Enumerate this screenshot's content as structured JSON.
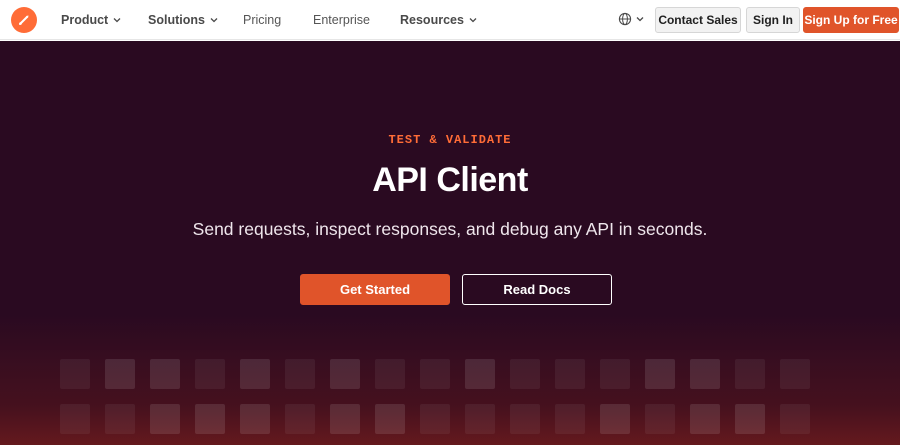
{
  "nav": {
    "items": [
      {
        "label": "Product",
        "has_menu": true
      },
      {
        "label": "Solutions",
        "has_menu": true
      },
      {
        "label": "Pricing",
        "has_menu": false
      },
      {
        "label": "Enterprise",
        "has_menu": false
      },
      {
        "label": "Resources",
        "has_menu": true
      }
    ],
    "contact_label": "Contact Sales",
    "signin_label": "Sign In",
    "signup_label": "Sign Up for Free",
    "language_icon": "globe-icon"
  },
  "hero": {
    "eyebrow": "TEST & VALIDATE",
    "title": "API Client",
    "subtitle": "Send requests, inspect responses, and debug any API in seconds.",
    "primary_cta": "Get Started",
    "secondary_cta": "Read Docs"
  },
  "colors": {
    "brand": "#ff6c37",
    "cta": "#e0542a",
    "hero_bg": "#2a0a21"
  }
}
